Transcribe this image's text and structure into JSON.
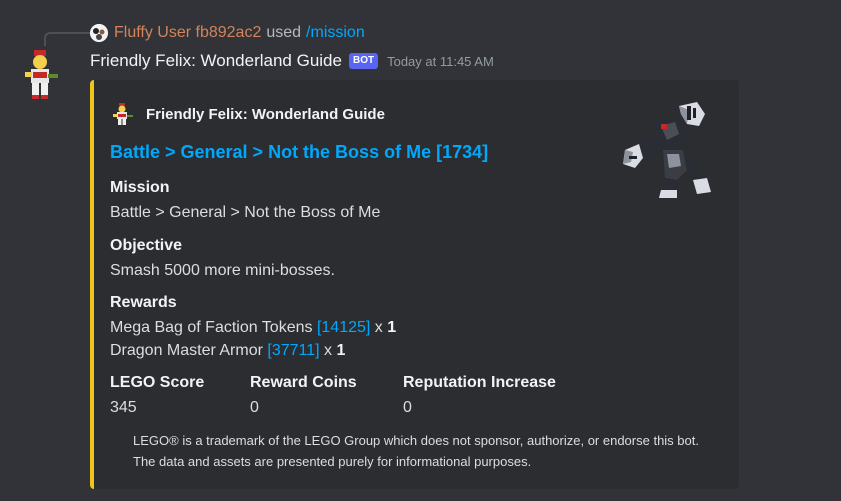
{
  "reply": {
    "user": "Fluffy User fb892ac2",
    "used": "used",
    "command": "/mission"
  },
  "message": {
    "author": "Friendly Felix: Wonderland Guide",
    "bot_tag": "BOT",
    "timestamp": "Today at 11:45 AM"
  },
  "embed": {
    "accent_color": "#f0c518",
    "author": "Friendly Felix: Wonderland Guide",
    "title": "Battle > General > Not the Boss of Me [1734]",
    "fields": {
      "mission": {
        "name": "Mission",
        "value": "Battle > General > Not the Boss of Me"
      },
      "objective": {
        "name": "Objective",
        "value": "Smash 5000 more mini-bosses."
      },
      "rewards": {
        "name": "Rewards",
        "items": [
          {
            "name": "Mega Bag of Faction Tokens",
            "id": "[14125]",
            "x": "x",
            "qty": "1"
          },
          {
            "name": "Dragon Master Armor",
            "id": "[37711]",
            "x": "x",
            "qty": "1"
          }
        ]
      },
      "lego_score": {
        "name": "LEGO Score",
        "value": "345"
      },
      "reward_coins": {
        "name": "Reward Coins",
        "value": "0"
      },
      "reputation": {
        "name": "Reputation Increase",
        "value": "0"
      }
    },
    "disclaimer": "LEGO® is a trademark of the LEGO Group which does not sponsor, authorize, or endorse this bot. The data and assets are presented purely for informational purposes."
  },
  "icons": {
    "reply_avatar": "user-avatar-icon",
    "bot_avatar": "minifig-guide-icon",
    "author_icon": "minifig-guide-icon",
    "thumbnail": "gorilla-boss-icon"
  }
}
